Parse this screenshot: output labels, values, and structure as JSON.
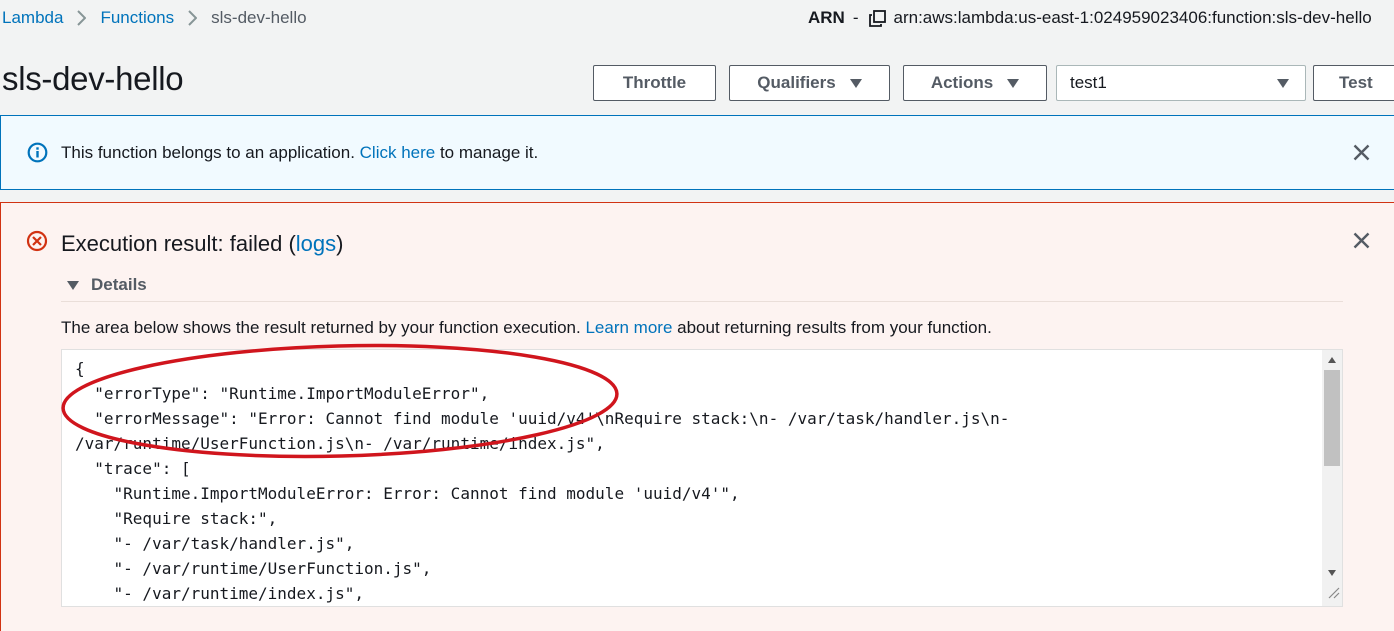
{
  "breadcrumb": {
    "items": [
      "Lambda",
      "Functions",
      "sls-dev-hello"
    ]
  },
  "arn": {
    "label": "ARN",
    "dash": "-",
    "value": "arn:aws:lambda:us-east-1:024959023406:function:sls-dev-hello"
  },
  "header": {
    "title": "sls-dev-hello",
    "buttons": {
      "throttle": "Throttle",
      "qualifiers": "Qualifiers",
      "actions": "Actions",
      "test": "Test"
    },
    "test_event_select": "test1"
  },
  "info_banner": {
    "text_before": "This function belongs to an application. ",
    "link": "Click here",
    "text_after": " to manage it."
  },
  "execution_result": {
    "title_prefix": "Execution result: failed (",
    "logs_link": "logs",
    "title_suffix": ")",
    "details_label": "Details",
    "description_before": "The area below shows the result returned by your function execution. ",
    "learn_more": "Learn more",
    "description_after": " about returning results from your function.",
    "code_lines": [
      "{",
      "  \"errorType\": \"Runtime.ImportModuleError\",",
      "  \"errorMessage\": \"Error: Cannot find module 'uuid/v4'\\nRequire stack:\\n- /var/task/handler.js\\n-",
      "/var/runtime/UserFunction.js\\n- /var/runtime/index.js\",",
      "  \"trace\": [",
      "    \"Runtime.ImportModuleError: Error: Cannot find module 'uuid/v4'\",",
      "    \"Require stack:\",",
      "    \"- /var/task/handler.js\",",
      "    \"- /var/runtime/UserFunction.js\",",
      "    \"- /var/runtime/index.js\","
    ]
  },
  "colors": {
    "link": "#0073bb",
    "info_border": "#0073bb",
    "info_bg": "#f1faff",
    "error_border": "#d13212",
    "error_bg": "#fdf3f1",
    "annotation": "#d0151d"
  },
  "icons": {
    "breadcrumb_separator": "chevron-right-icon",
    "copy": "copy-icon",
    "info": "info-icon",
    "error": "error-circle-icon",
    "close": "close-icon"
  }
}
